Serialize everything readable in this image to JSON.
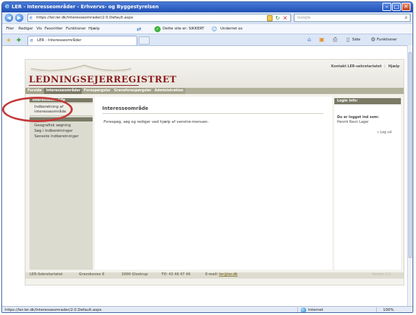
{
  "window": {
    "title": "LER - Interesseområder - Erhvervs- og Byggestyrelsen",
    "controls": [
      "minimize",
      "maximize",
      "close"
    ]
  },
  "address_bar": {
    "url": "https://ler.ler.dk/Interesseomrader/2.0.Default.aspx",
    "search_placeholder": "Google"
  },
  "menu": {
    "items": [
      "Filer",
      "Rediger",
      "Vis",
      "Favoritter",
      "Funktioner",
      "Hjælp"
    ],
    "security_text": "Dette site er: SIKKERT",
    "security_badge_text": "Underret os"
  },
  "tabs": {
    "active_tab": "LER - Interesseområder",
    "commands": [
      "Side",
      "Funktioner"
    ]
  },
  "site": {
    "logo": "LEDNINGSEJERREGISTRET",
    "top_links": [
      "Kontakt LER-sekretariatet",
      "Hjælp"
    ],
    "nav_tabs": [
      "Forside",
      "Interesseområder",
      "Forespørgsler",
      "Graveforespørgsler",
      "Administration"
    ],
    "active_nav_tab": "Interesseområder",
    "left_menu": {
      "selected_label": "Interesseområde",
      "highlighted_item": "Indberetning af interesseområde",
      "items": [
        "Geografisk søgning",
        "Søg i indberetninger",
        "Seneste indberetninger"
      ]
    },
    "main": {
      "title": "Interesseområde",
      "body": "Forespøg, søg og rediger ved hjælp af venstre-menuen."
    },
    "login_info": {
      "header": "Login info:",
      "line1": "Du er logget ind som:",
      "line2": "Henrik Ravn Lager",
      "logout": "»  Log ud"
    },
    "footer": {
      "org": "LER-Sekretariatet",
      "street": "Granskoven 8",
      "city": "2600 Glostrup",
      "phone": "Tlf: 43 48 47 46",
      "email_label": "E-mail: ",
      "email": "ler@ler.dk",
      "version": "Version 2.0"
    }
  },
  "status_bar": {
    "url": "https://ler.ler.dk/Interesseomrader/2.0.Default.aspx",
    "zone": "Internet",
    "zoom": "100%"
  },
  "colors": {
    "title_bar": "#1f4fb4",
    "logo_red": "#8a1d1d",
    "nav_bar": "#b2b19b",
    "nav_active": "#7a7a66",
    "annotation_circle": "#c43a3a"
  }
}
